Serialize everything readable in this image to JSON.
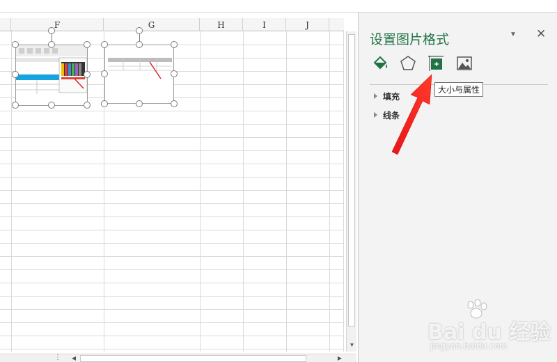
{
  "sheet": {
    "columns": [
      "F",
      "G",
      "H",
      "I",
      "J"
    ]
  },
  "panel": {
    "title": "设置图片格式",
    "tabs": [
      "fill-line",
      "effects",
      "size-properties",
      "picture"
    ],
    "active_tab": "fill-line",
    "sections": [
      "填充",
      "线条"
    ]
  },
  "tooltip": {
    "text": "大小与属性"
  },
  "watermark": {
    "brand": "Bai du 经验",
    "url": "jingyan.baidu.com"
  },
  "colors": {
    "accent": "#217346",
    "arrow": "#e8161a",
    "cell_blue": "#17a2e0"
  }
}
